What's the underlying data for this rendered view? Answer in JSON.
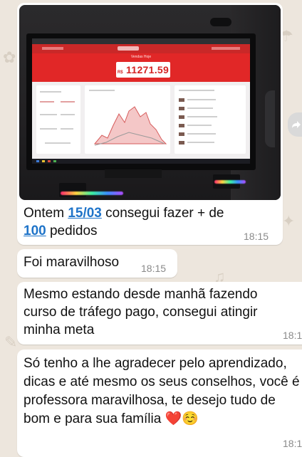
{
  "chat": {
    "image_message": {
      "screenshot": {
        "top_bar_label": "Vendas Hoje",
        "sales_currency": "R$",
        "sales_value": "11271.59"
      },
      "caption_parts": [
        "Ontem ",
        "15/03",
        " consegui fazer + de ",
        "100",
        " pedidos"
      ],
      "time": "18:15"
    },
    "messages": [
      {
        "text": "Foi maravilhoso",
        "time": "18:15"
      },
      {
        "text": "Mesmo estando desde manhã fazendo curso de tráfego pago, consegui atingir minha meta",
        "time": "18:1"
      },
      {
        "text": "Só tenho a lhe agradecer pelo aprendizado, dicas e até mesmo os seus conselhos, você é professora maravilhosa, te desejo tudo de bom e para sua família",
        "emoji_1": "❤️",
        "emoji_2": "☺️",
        "time": "18:1"
      }
    ]
  },
  "colors": {
    "wallpaper": "#ede6dd",
    "bubble": "#ffffff",
    "link": "#1f74c9",
    "dashboard_red": "#e12727"
  }
}
